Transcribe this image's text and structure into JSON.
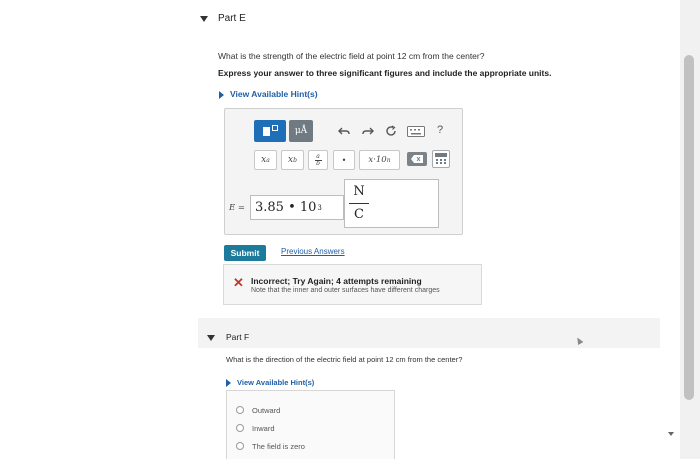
{
  "partE": {
    "title": "Part E",
    "question": "What is the strength of the electric field at point 12 cm from the center?",
    "instruction": "Express your answer to three significant figures and include the appropriate units.",
    "hints_label": "View Available Hint(s)",
    "toolbar": {
      "btn_templates": "▪▫",
      "btn_units": "μÅ",
      "undo_icon": "undo-icon",
      "redo_icon": "redo-icon",
      "reset_icon": "reset-icon",
      "keyboard_icon": "keyboard-icon",
      "help_label": "?",
      "sup_label": "xᵃ",
      "sub_label": "x_b",
      "frac_label": "a/b",
      "dot_label": "•",
      "sci_label": "x·10ⁿ",
      "backspace_icon": "backspace-icon",
      "calc_icon": "calculator-icon"
    },
    "answer_label": "E =",
    "answer_value": "3.85 • 10",
    "answer_exponent": "3",
    "unit_numerator": "N",
    "unit_denominator": "C",
    "submit_label": "Submit",
    "previous_answers": "Previous Answers",
    "feedback_title": "Incorrect; Try Again; 4 attempts remaining",
    "feedback_note": "Note that the inner and outer surfaces have different charges"
  },
  "partF": {
    "title": "Part F",
    "question": "What is the direction of the electric field at point 12 cm from the center?",
    "hints_label": "View Available Hint(s)",
    "options": [
      "Outward",
      "Inward",
      "The field is zero"
    ]
  },
  "colors": {
    "submit": "#1c7a9c",
    "link": "#1f5fa7",
    "error": "#c0392b"
  }
}
